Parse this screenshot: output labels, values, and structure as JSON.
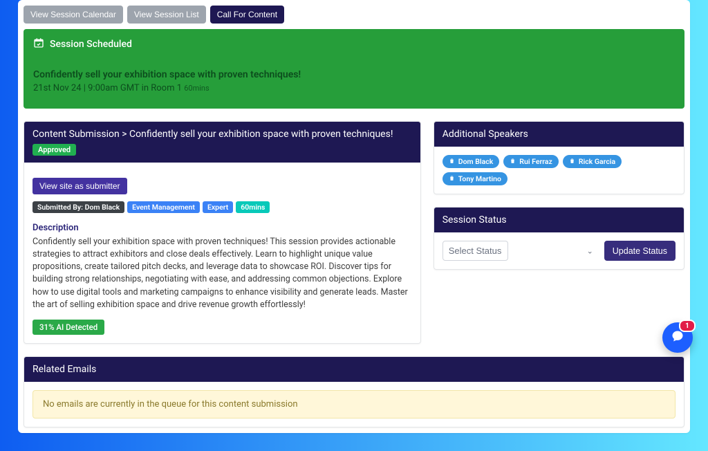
{
  "tabs": {
    "calendar": "View Session Calendar",
    "list": "View Session List",
    "call": "Call For Content"
  },
  "scheduled": {
    "header": "Session Scheduled",
    "title": "Confidently sell your exhibition space with proven techniques!",
    "date_line_prefix": "21st Nov 24 | 9:00am GMT in Room 1",
    "mins": "60mins"
  },
  "submission": {
    "breadcrumb": "Content Submission > Confidently sell your exhibition space with proven techniques!",
    "approved": "Approved",
    "view_as_submitter": "View site as submitter",
    "submitted_by": "Submitted By: Dom Black",
    "tag_topic": "Event Management",
    "tag_level": "Expert",
    "tag_duration": "60mins",
    "desc_label": "Description",
    "description": "Confidently sell your exhibition space with proven techniques! This session provides actionable strategies to attract exhibitors and close deals effectively. Learn to highlight unique value propositions, create tailored pitch decks, and leverage data to showcase ROI. Discover tips for building strong relationships, negotiating with ease, and addressing common objections. Explore how to use digital tools and marketing campaigns to enhance visibility and generate leads. Master the art of selling exhibition space and drive revenue growth effortlessly!",
    "ai_detected": "31% AI Detected"
  },
  "speakers": {
    "header": "Additional Speakers",
    "list": [
      "Dom Black",
      "Rui Ferraz",
      "Rick Garcia",
      "Tony Martino"
    ]
  },
  "status": {
    "header": "Session Status",
    "placeholder": "Select Status",
    "update": "Update Status"
  },
  "emails": {
    "header": "Related Emails",
    "empty": "No emails are currently in the queue for this content submission"
  },
  "chat": {
    "badge": "1"
  }
}
